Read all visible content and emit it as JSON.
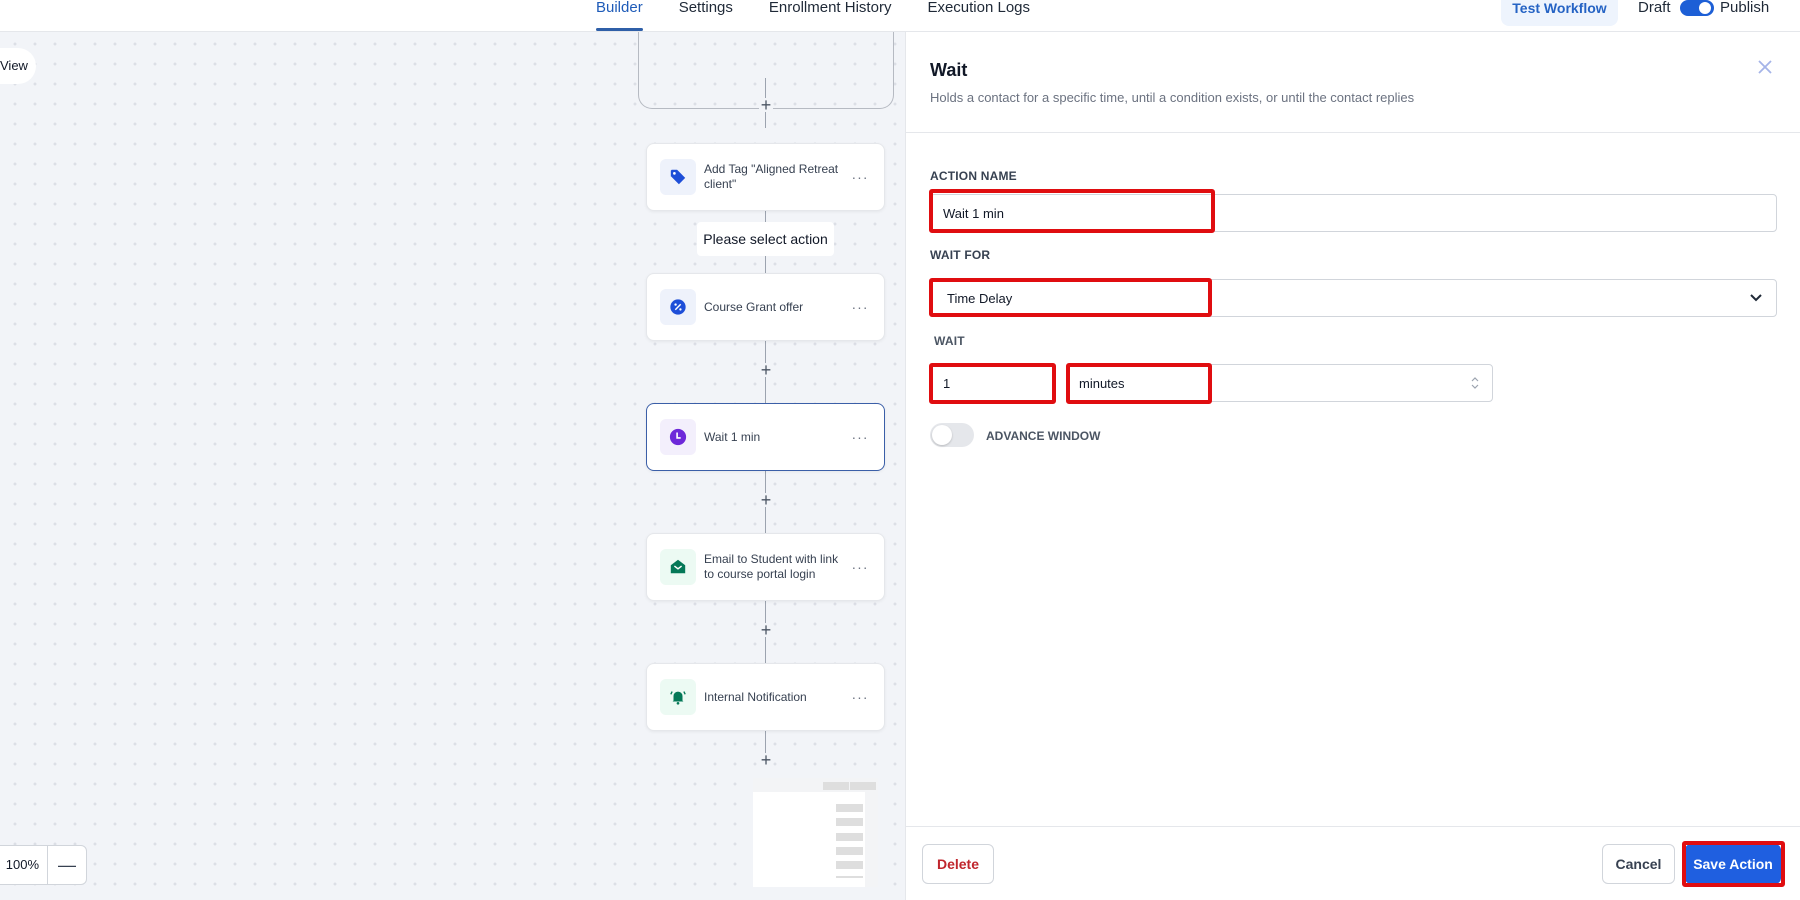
{
  "topbar": {
    "tabs": [
      {
        "label": "Builder",
        "active": true
      },
      {
        "label": "Settings",
        "active": false
      },
      {
        "label": "Enrollment History",
        "active": false
      },
      {
        "label": "Execution Logs",
        "active": false
      }
    ],
    "test_workflow_label": "Test Workflow",
    "draft_label": "Draft",
    "publish_label": "Publish",
    "publish_toggle_on": true
  },
  "canvas": {
    "view_label": "View",
    "select_hint": "Please select action",
    "nodes": [
      {
        "label": "Add Tag \"Aligned Retreat client\"",
        "icon": "tag-icon",
        "icon_color": "#1d4ed8",
        "icon_bg": "#eef2fb"
      },
      {
        "label": "Course Grant offer",
        "icon": "discount-badge-icon",
        "icon_color": "#1d4ed8",
        "icon_bg": "#eef2fb"
      },
      {
        "label": "Wait 1 min",
        "icon": "clock-icon",
        "icon_color": "#6d28d9",
        "icon_bg": "#f3effc",
        "selected": true
      },
      {
        "label": "Email to Student with link to course portal login",
        "icon": "envelope-open-icon",
        "icon_color": "#047857",
        "icon_bg": "#ecfaf3"
      },
      {
        "label": "Internal Notification",
        "icon": "bell-ringing-icon",
        "icon_color": "#047857",
        "icon_bg": "#ecfaf3"
      }
    ],
    "more_label": "···",
    "add_step_label": "+",
    "zoom_level": "100%",
    "zoom_out_label": "—"
  },
  "panel": {
    "title": "Wait",
    "subtitle": "Holds a contact for a specific time, until a condition exists, or until the contact replies",
    "action_name_label": "ACTION NAME",
    "action_name_value": "Wait 1 min",
    "wait_for_label": "WAIT FOR",
    "wait_for_value": "Time Delay",
    "wait_label": "WAIT",
    "wait_amount": "1",
    "wait_unit": "minutes",
    "advance_window_label": "ADVANCE WINDOW",
    "advance_window_on": false,
    "delete_label": "Delete",
    "cancel_label": "Cancel",
    "save_label": "Save Action"
  },
  "colors": {
    "accent": "#1f5fe0",
    "highlight": "#e00d10",
    "delete": "#c0262d"
  }
}
